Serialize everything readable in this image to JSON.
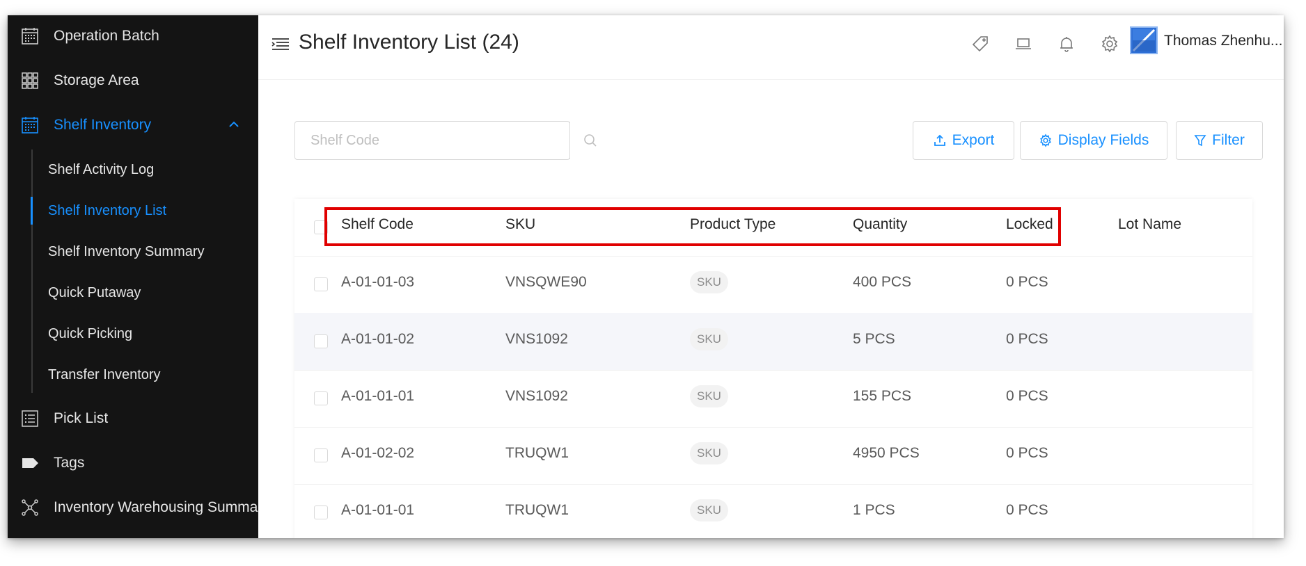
{
  "sidebar": {
    "items_top": [
      {
        "label": "Operation Batch",
        "icon": "calendar-icon"
      },
      {
        "label": "Storage Area",
        "icon": "grid-icon"
      },
      {
        "label": "Shelf Inventory",
        "icon": "calendar-icon",
        "active": true
      }
    ],
    "sub_items": [
      {
        "label": "Shelf Activity Log"
      },
      {
        "label": "Shelf Inventory List",
        "active": true
      },
      {
        "label": "Shelf Inventory Summary"
      },
      {
        "label": "Quick Putaway"
      },
      {
        "label": "Quick Picking"
      },
      {
        "label": "Transfer Inventory"
      }
    ],
    "items_bottom": [
      {
        "label": "Pick List",
        "icon": "list-icon"
      },
      {
        "label": "Tags",
        "icon": "tag-icon"
      },
      {
        "label": "Inventory Warehousing Summary",
        "icon": "network-icon"
      }
    ]
  },
  "header": {
    "title": "Shelf Inventory List (24)",
    "user_name": "Thomas Zhenhu..."
  },
  "toolbar": {
    "search_placeholder": "Shelf Code",
    "export_label": "Export",
    "display_fields_label": "Display Fields",
    "filter_label": "Filter"
  },
  "table": {
    "columns": [
      "Shelf Code",
      "SKU",
      "Product Type",
      "Quantity",
      "Locked",
      "Lot Name"
    ],
    "rows": [
      {
        "shelf_code": "A-01-01-03",
        "sku": "VNSQWE90",
        "product_type": "SKU",
        "quantity": "400 PCS",
        "locked": "0 PCS",
        "lot_name": ""
      },
      {
        "shelf_code": "A-01-01-02",
        "sku": "VNS1092",
        "product_type": "SKU",
        "quantity": "5 PCS",
        "locked": "0 PCS",
        "lot_name": ""
      },
      {
        "shelf_code": "A-01-01-01",
        "sku": "VNS1092",
        "product_type": "SKU",
        "quantity": "155 PCS",
        "locked": "0 PCS",
        "lot_name": ""
      },
      {
        "shelf_code": "A-01-02-02",
        "sku": "TRUQW1",
        "product_type": "SKU",
        "quantity": "4950 PCS",
        "locked": "0 PCS",
        "lot_name": ""
      },
      {
        "shelf_code": "A-01-01-01",
        "sku": "TRUQW1",
        "product_type": "SKU",
        "quantity": "1 PCS",
        "locked": "0 PCS",
        "lot_name": ""
      }
    ]
  },
  "colors": {
    "accent": "#1890ff",
    "sidebar_bg": "#141414",
    "highlight": "#e00000"
  }
}
